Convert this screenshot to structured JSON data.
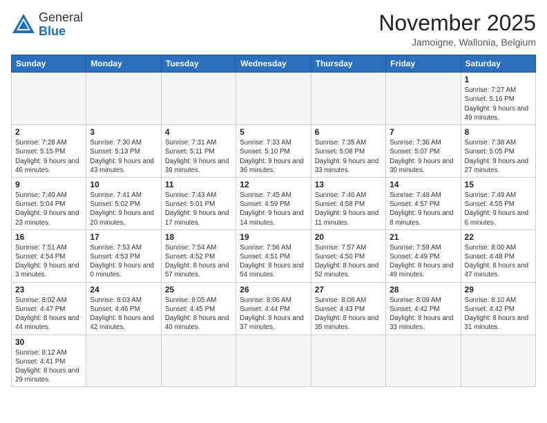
{
  "logo": {
    "general": "General",
    "blue": "Blue"
  },
  "title": {
    "month_year": "November 2025",
    "location": "Jamoigne, Wallonia, Belgium"
  },
  "weekdays": [
    "Sunday",
    "Monday",
    "Tuesday",
    "Wednesday",
    "Thursday",
    "Friday",
    "Saturday"
  ],
  "weeks": [
    [
      {
        "day": "",
        "info": ""
      },
      {
        "day": "",
        "info": ""
      },
      {
        "day": "",
        "info": ""
      },
      {
        "day": "",
        "info": ""
      },
      {
        "day": "",
        "info": ""
      },
      {
        "day": "",
        "info": ""
      },
      {
        "day": "1",
        "info": "Sunrise: 7:27 AM\nSunset: 5:16 PM\nDaylight: 9 hours and 49 minutes."
      }
    ],
    [
      {
        "day": "2",
        "info": "Sunrise: 7:28 AM\nSunset: 5:15 PM\nDaylight: 9 hours and 46 minutes."
      },
      {
        "day": "3",
        "info": "Sunrise: 7:30 AM\nSunset: 5:13 PM\nDaylight: 9 hours and 43 minutes."
      },
      {
        "day": "4",
        "info": "Sunrise: 7:31 AM\nSunset: 5:11 PM\nDaylight: 9 hours and 39 minutes."
      },
      {
        "day": "5",
        "info": "Sunrise: 7:33 AM\nSunset: 5:10 PM\nDaylight: 9 hours and 36 minutes."
      },
      {
        "day": "6",
        "info": "Sunrise: 7:35 AM\nSunset: 5:08 PM\nDaylight: 9 hours and 33 minutes."
      },
      {
        "day": "7",
        "info": "Sunrise: 7:36 AM\nSunset: 5:07 PM\nDaylight: 9 hours and 30 minutes."
      },
      {
        "day": "8",
        "info": "Sunrise: 7:38 AM\nSunset: 5:05 PM\nDaylight: 9 hours and 27 minutes."
      }
    ],
    [
      {
        "day": "9",
        "info": "Sunrise: 7:40 AM\nSunset: 5:04 PM\nDaylight: 9 hours and 23 minutes."
      },
      {
        "day": "10",
        "info": "Sunrise: 7:41 AM\nSunset: 5:02 PM\nDaylight: 9 hours and 20 minutes."
      },
      {
        "day": "11",
        "info": "Sunrise: 7:43 AM\nSunset: 5:01 PM\nDaylight: 9 hours and 17 minutes."
      },
      {
        "day": "12",
        "info": "Sunrise: 7:45 AM\nSunset: 4:59 PM\nDaylight: 9 hours and 14 minutes."
      },
      {
        "day": "13",
        "info": "Sunrise: 7:46 AM\nSunset: 4:58 PM\nDaylight: 9 hours and 11 minutes."
      },
      {
        "day": "14",
        "info": "Sunrise: 7:48 AM\nSunset: 4:57 PM\nDaylight: 9 hours and 8 minutes."
      },
      {
        "day": "15",
        "info": "Sunrise: 7:49 AM\nSunset: 4:55 PM\nDaylight: 9 hours and 6 minutes."
      }
    ],
    [
      {
        "day": "16",
        "info": "Sunrise: 7:51 AM\nSunset: 4:54 PM\nDaylight: 9 hours and 3 minutes."
      },
      {
        "day": "17",
        "info": "Sunrise: 7:53 AM\nSunset: 4:53 PM\nDaylight: 9 hours and 0 minutes."
      },
      {
        "day": "18",
        "info": "Sunrise: 7:54 AM\nSunset: 4:52 PM\nDaylight: 8 hours and 57 minutes."
      },
      {
        "day": "19",
        "info": "Sunrise: 7:56 AM\nSunset: 4:51 PM\nDaylight: 8 hours and 54 minutes."
      },
      {
        "day": "20",
        "info": "Sunrise: 7:57 AM\nSunset: 4:50 PM\nDaylight: 8 hours and 52 minutes."
      },
      {
        "day": "21",
        "info": "Sunrise: 7:59 AM\nSunset: 4:49 PM\nDaylight: 8 hours and 49 minutes."
      },
      {
        "day": "22",
        "info": "Sunrise: 8:00 AM\nSunset: 4:48 PM\nDaylight: 8 hours and 47 minutes."
      }
    ],
    [
      {
        "day": "23",
        "info": "Sunrise: 8:02 AM\nSunset: 4:47 PM\nDaylight: 8 hours and 44 minutes."
      },
      {
        "day": "24",
        "info": "Sunrise: 8:03 AM\nSunset: 4:46 PM\nDaylight: 8 hours and 42 minutes."
      },
      {
        "day": "25",
        "info": "Sunrise: 8:05 AM\nSunset: 4:45 PM\nDaylight: 8 hours and 40 minutes."
      },
      {
        "day": "26",
        "info": "Sunrise: 8:06 AM\nSunset: 4:44 PM\nDaylight: 8 hours and 37 minutes."
      },
      {
        "day": "27",
        "info": "Sunrise: 8:08 AM\nSunset: 4:43 PM\nDaylight: 8 hours and 35 minutes."
      },
      {
        "day": "28",
        "info": "Sunrise: 8:09 AM\nSunset: 4:42 PM\nDaylight: 8 hours and 33 minutes."
      },
      {
        "day": "29",
        "info": "Sunrise: 8:10 AM\nSunset: 4:42 PM\nDaylight: 8 hours and 31 minutes."
      }
    ],
    [
      {
        "day": "30",
        "info": "Sunrise: 8:12 AM\nSunset: 4:41 PM\nDaylight: 8 hours and 29 minutes."
      },
      {
        "day": "",
        "info": ""
      },
      {
        "day": "",
        "info": ""
      },
      {
        "day": "",
        "info": ""
      },
      {
        "day": "",
        "info": ""
      },
      {
        "day": "",
        "info": ""
      },
      {
        "day": "",
        "info": ""
      }
    ]
  ]
}
